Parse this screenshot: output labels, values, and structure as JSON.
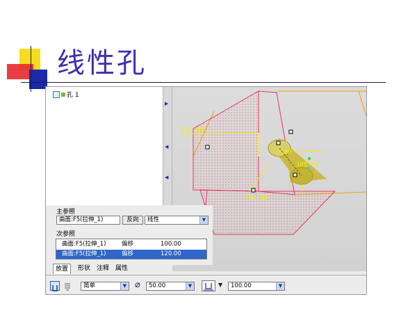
{
  "slide": {
    "title": "线性孔"
  },
  "model_tree": {
    "node_label": "孔 1"
  },
  "references": {
    "primary_label": "主参照",
    "primary_field": "曲面:F5(拉伸_1)",
    "reverse_button": "反向",
    "placement_type": "线性",
    "secondary_label": "次参照",
    "secondary_rows": [
      {
        "ref": "曲面:F5(拉伸_1)",
        "type": "偏移",
        "value": "100.00"
      },
      {
        "ref": "曲面:F5(拉伸_1)",
        "type": "偏移",
        "value": "120.00"
      }
    ]
  },
  "tabs": [
    "放置",
    "形状",
    "注释",
    "属性"
  ],
  "dashboard": {
    "hole_type": "简单",
    "diameter": "50.00",
    "depth": "100.00"
  },
  "viewport": {
    "dim_left": "120.00",
    "dim_top": "0.00",
    "dim_right": "100.00",
    "dim_bottom": "100.00"
  },
  "colors": {
    "title": "#3a2fb2",
    "selection": "#2f66c9",
    "model_edge": "#e8345a",
    "dimension": "#f0f000"
  }
}
